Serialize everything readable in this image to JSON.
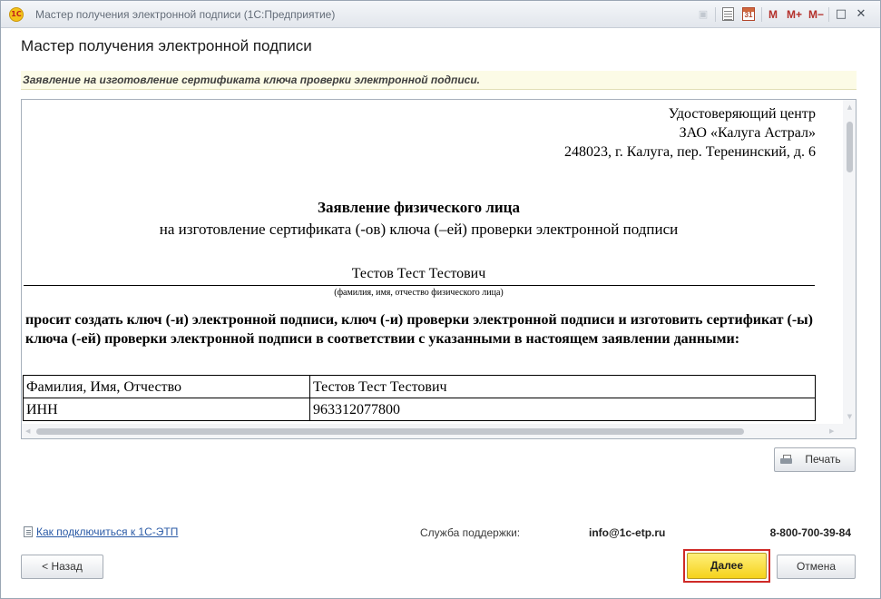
{
  "window": {
    "title": "Мастер получения электронной подписи  (1С:Предприятие)",
    "logo_text": "1С",
    "memory_buttons": [
      "M",
      "M+",
      "M−"
    ]
  },
  "form": {
    "title": "Мастер получения электронной подписи",
    "hint": "Заявление на изготовление сертификата ключа проверки электронной подписи."
  },
  "document": {
    "recipient": [
      "Удостоверяющий центр",
      "ЗАО «Калуга Астрал»",
      "248023, г. Калуга, пер. Теренинский, д. 6"
    ],
    "title_bold": "Заявление физического лица",
    "title_sub": "на изготовление сертификата (-ов) ключа (–ей) проверки электронной подписи",
    "applicant_name": "Тестов Тест Тестович",
    "applicant_caption": "(фамилия, имя, отчество физического лица)",
    "request_text": "просит создать ключ (-и) электронной подписи, ключ (-и) проверки электронной подписи и изготовить сертификат (-ы) ключа (-ей) проверки электронной подписи в соответствии с указанными в настоящем заявлении данными:",
    "table": [
      [
        "Фамилия, Имя, Отчество",
        "Тестов Тест Тестович"
      ],
      [
        "ИНН",
        "963312077800"
      ]
    ]
  },
  "buttons": {
    "print": "Печать",
    "back": "< Назад",
    "next": "Далее",
    "cancel": "Отмена"
  },
  "footer": {
    "help_link": "Как подключиться к 1С-ЭТП",
    "support_label": "Служба поддержки:",
    "support_email": "info@1c-etp.ru",
    "support_phone": "8-800-700-39-84"
  },
  "icons": [
    "app-logo-icon",
    "monitor-icon",
    "calculator-icon",
    "calendar-icon",
    "minimize-icon",
    "maximize-icon",
    "close-icon",
    "printer-icon",
    "document-icon"
  ],
  "colors": {
    "next_button": "#f5d21c",
    "highlight_border": "#cf2a27",
    "hint_background": "#fcfbe6",
    "link": "#2a5aa6"
  }
}
